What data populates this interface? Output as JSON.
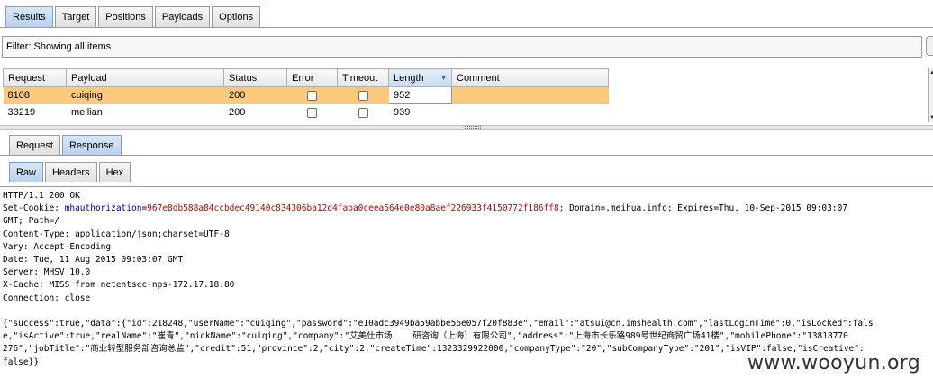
{
  "top_tabs": [
    "Results",
    "Target",
    "Positions",
    "Payloads",
    "Options"
  ],
  "filter": {
    "text": "Filter:  Showing all items"
  },
  "results": {
    "columns": [
      "Request",
      "Payload",
      "Status",
      "Error",
      "Timeout",
      "Length",
      "Comment"
    ],
    "sorted_column": "Length",
    "rows": [
      {
        "request": "8108",
        "payload": "cuiqing",
        "status": "200",
        "error": false,
        "timeout": false,
        "length": "952",
        "comment": "",
        "selected": true
      },
      {
        "request": "33219",
        "payload": "meilian",
        "status": "200",
        "error": false,
        "timeout": false,
        "length": "939",
        "comment": "",
        "selected": false
      }
    ]
  },
  "req_tabs": [
    "Request",
    "Response"
  ],
  "sub_tabs": [
    "Raw",
    "Headers",
    "Hex"
  ],
  "response": {
    "status_line": "HTTP/1.1 200 OK",
    "set_cookie_prefix": "Set-Cookie: ",
    "cookie_name": "mhauthorization",
    "cookie_eq": "=",
    "cookie_value": "967e8db588a84ccbdec49140c834306ba12d4faba0ceea564e0e80a8aef226933f4150772f186ff8",
    "cookie_rest": "; Domain=.meihua.info; Expires=Thu, 10-Sep-2015 09:03:07",
    "cookie_cont": "GMT; Path=/",
    "headers": [
      "Content-Type: application/json;charset=UTF-8",
      "Vary: Accept-Encoding",
      "Date: Tue, 11 Aug 2015 09:03:07 GMT",
      "Server: MHSV 10.0",
      "X-Cache: MISS from netentsec-nps-172.17.18.80",
      "Connection: close"
    ],
    "body_lines": [
      "{\"success\":true,\"data\":{\"id\":218248,\"userName\":\"cuiqing\",\"password\":\"e10adc3949ba59abbe56e057f20f883e\",\"email\":\"atsui@cn.imshealth.com\",\"lastLoginTime\":0,\"isLocked\":fals",
      "e,\"isActive\":true,\"realName\":\"崔青\",\"nickName\":\"cuiqing\",\"company\":\"艾美仕市场    研咨询（上海）有限公司\",\"address\":\"上海市长乐路989号世纪商贸广场41楼\",\"mobilePhone\":\"13818770",
      "276\",\"jobTitle\":\"商业转型服务部咨询总监\",\"credit\":51,\"province\":2,\"city\":2,\"createTime\":1323329922000,\"companyType\":\"20\",\"subCompanyType\":\"201\",\"isVIP\":false,\"isCreative\":",
      "false}}"
    ]
  },
  "watermark": "www.wooyun.org"
}
